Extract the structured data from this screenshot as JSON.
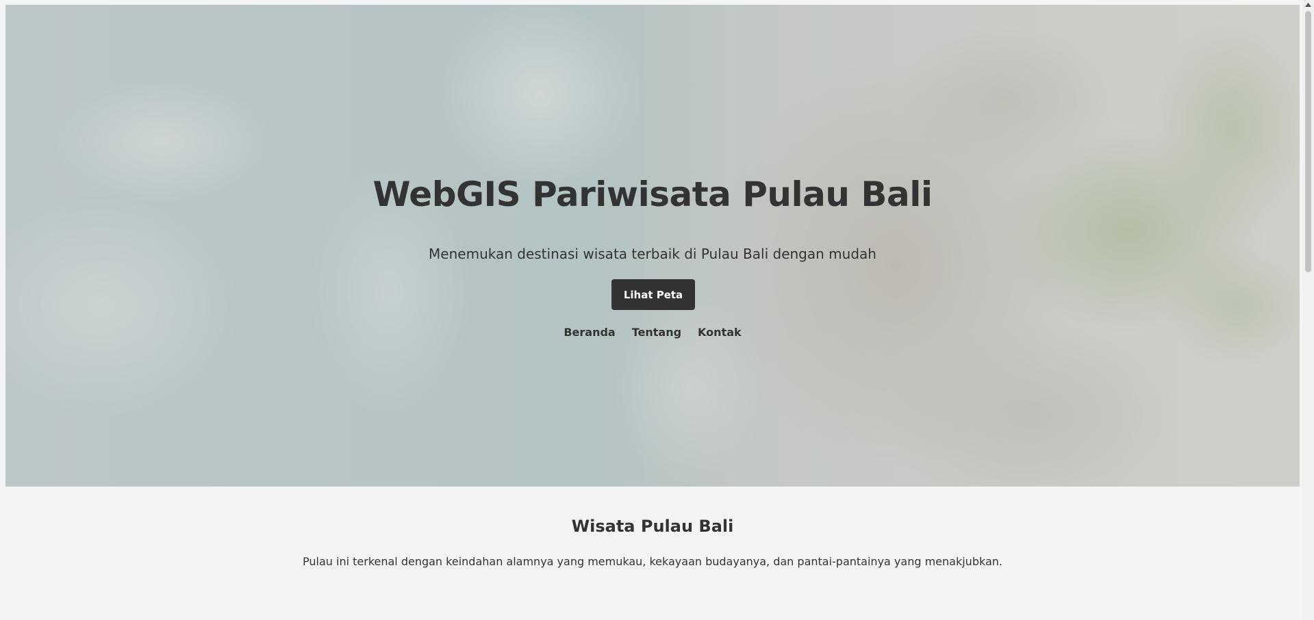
{
  "hero": {
    "title": "WebGIS Pariwisata Pulau Bali",
    "subtitle": "Menemukan destinasi wisata terbaik di Pulau Bali dengan mudah",
    "button_label": "Lihat Peta",
    "background_icon": "coastline-aerial-photo"
  },
  "nav": {
    "items": [
      {
        "label": "Beranda"
      },
      {
        "label": "Tentang"
      },
      {
        "label": "Kontak"
      }
    ]
  },
  "about": {
    "title": "Wisata Pulau Bali",
    "text": "Pulau ini terkenal dengan keindahan alamnya yang memukau, kekayaan budayanya, dan pantai-pantainya yang menakjubkan."
  },
  "colors": {
    "text": "#333333",
    "button_bg": "#333333",
    "button_text": "#ffffff",
    "page_bg": "#f4f4f4",
    "hero_overlay": "#b9c5c4"
  },
  "scrollbar": {
    "up_icon": "chevron-up-icon"
  }
}
